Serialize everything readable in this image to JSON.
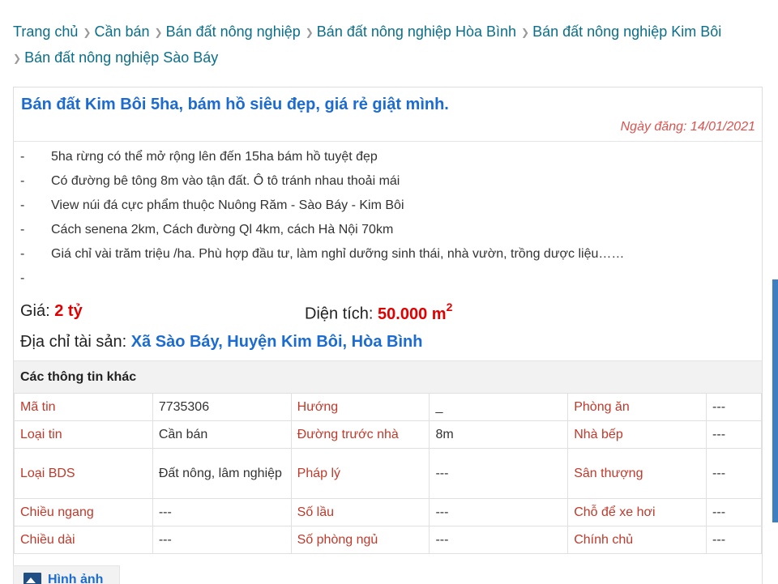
{
  "breadcrumb": [
    "Trang chủ",
    "Cần bán",
    "Bán đất nông nghiệp",
    "Bán đất nông nghiệp Hòa Bình",
    "Bán đất nông nghiệp Kim Bôi",
    "Bán đất nông nghiệp Sào Báy"
  ],
  "listing": {
    "title": "Bán đất Kim Bôi 5ha, bám hồ siêu đẹp, giá rẻ giật mình.",
    "posted_label": "Ngày đăng:",
    "posted_date": "14/01/2021",
    "description": [
      "5ha rừng có thể mở rộng lên đến 15ha bám hồ tuyệt đẹp",
      "Có đường bê tông 8m vào tận đất. Ô tô tránh nhau thoải mái",
      "View núi đá cực phẩm thuộc Nuông Răm - Sào Báy - Kim Bôi",
      "Cách senena 2km, Cách đường Ql 4km, cách Hà Nội 70km",
      "Giá chỉ vài trăm triệu /ha. Phù hợp đầu tư, làm nghỉ dưỡng sinh thái, nhà vườn, trồng dược liệu……",
      ""
    ],
    "price_label": "Giá:",
    "price_value": "2 tỷ",
    "area_label": "Diện tích:",
    "area_value": "50.000 m",
    "area_unit_sup": "2",
    "address_label": "Địa chỉ tài sản:",
    "address_value": "Xã Sào Báy, Huyện Kim Bôi, Hòa Bình"
  },
  "other_info": {
    "heading": "Các thông tin khác",
    "rows": [
      [
        [
          "Mã tin",
          "7735306"
        ],
        [
          "Hướng",
          "_"
        ],
        [
          "Phòng ăn",
          "---"
        ]
      ],
      [
        [
          "Loại tin",
          "Cần bán"
        ],
        [
          "Đường trước nhà",
          "8m"
        ],
        [
          "Nhà bếp",
          "---"
        ]
      ],
      [
        [
          "Loại BDS",
          "Đất nông, lâm nghiệp"
        ],
        [
          "Pháp lý",
          "---"
        ],
        [
          "Sân thượng",
          "---"
        ]
      ],
      [
        [
          "Chiều ngang",
          "---"
        ],
        [
          "Số lầu",
          "---"
        ],
        [
          "Chỗ để xe hơi",
          "---"
        ]
      ],
      [
        [
          "Chiều dài",
          "---"
        ],
        [
          "Số phòng ngủ",
          "---"
        ],
        [
          "Chính chủ",
          "---"
        ]
      ]
    ]
  },
  "images_tab": {
    "label": "Hình ảnh",
    "icon": "image-icon"
  }
}
